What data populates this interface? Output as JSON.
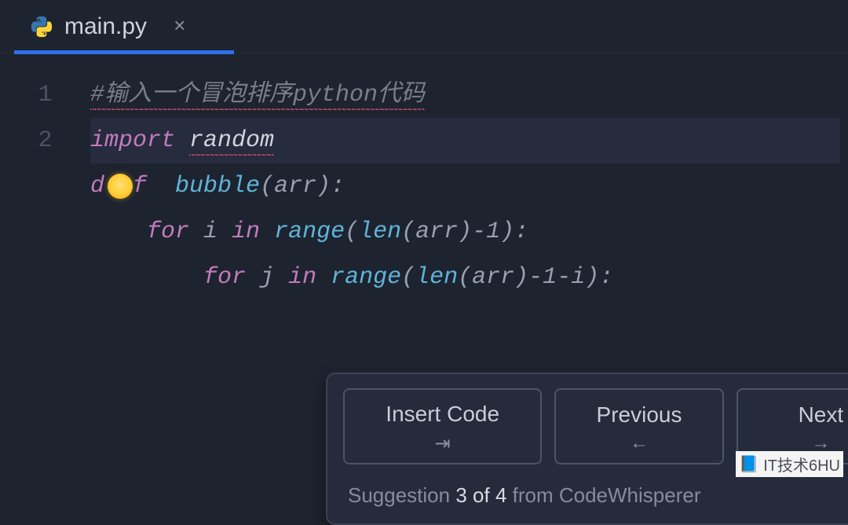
{
  "tab": {
    "file_name": "main.py",
    "language": "python"
  },
  "editor": {
    "line_numbers": [
      "1",
      "2"
    ],
    "lines": [
      {
        "tokens": [
          {
            "text": "#输入一个冒泡排序python代码",
            "cls": "tok-comment"
          }
        ],
        "squiggle": true
      },
      {
        "tokens": [
          {
            "text": "import",
            "cls": "tok-keyword"
          },
          {
            "text": " ",
            "cls": "tok-plain"
          },
          {
            "text": "random",
            "cls": "tok-module"
          }
        ],
        "highlight": true,
        "squiggle_index": 2
      },
      {
        "tokens": [
          {
            "text": "d  f  ",
            "cls": "tok-keyword"
          },
          {
            "text": "bubble",
            "cls": "tok-func"
          },
          {
            "text": "(arr):",
            "cls": "tok-plain"
          }
        ],
        "bulb": true
      },
      {
        "tokens": [
          {
            "text": "    ",
            "cls": "tok-plain"
          },
          {
            "text": "for",
            "cls": "tok-keyword"
          },
          {
            "text": " i ",
            "cls": "tok-plain"
          },
          {
            "text": "in",
            "cls": "tok-keyword"
          },
          {
            "text": " ",
            "cls": "tok-plain"
          },
          {
            "text": "range",
            "cls": "tok-func"
          },
          {
            "text": "(",
            "cls": "tok-plain"
          },
          {
            "text": "len",
            "cls": "tok-func"
          },
          {
            "text": "(arr)-",
            "cls": "tok-plain"
          },
          {
            "text": "1",
            "cls": "tok-plain"
          },
          {
            "text": "):",
            "cls": "tok-plain"
          }
        ]
      },
      {
        "tokens": [
          {
            "text": "        ",
            "cls": "tok-plain"
          },
          {
            "text": "for",
            "cls": "tok-keyword"
          },
          {
            "text": " j ",
            "cls": "tok-plain"
          },
          {
            "text": "in",
            "cls": "tok-keyword"
          },
          {
            "text": " ",
            "cls": "tok-plain"
          },
          {
            "text": "range",
            "cls": "tok-func"
          },
          {
            "text": "(",
            "cls": "tok-plain"
          },
          {
            "text": "len",
            "cls": "tok-func"
          },
          {
            "text": "(arr)-",
            "cls": "tok-plain"
          },
          {
            "text": "1",
            "cls": "tok-plain"
          },
          {
            "text": "-i):",
            "cls": "tok-plain"
          }
        ]
      }
    ]
  },
  "panel": {
    "buttons": {
      "insert": {
        "label": "Insert Code",
        "glyph": "⇥"
      },
      "previous": {
        "label": "Previous",
        "glyph": "←"
      },
      "next": {
        "label": "Next",
        "glyph": "→"
      }
    },
    "status": {
      "prefix": "Suggestion ",
      "current": "3",
      "of_word": " of ",
      "total": "4",
      "suffix": " from CodeWhisperer"
    }
  },
  "watermark": {
    "text": "IT技术6HU"
  }
}
